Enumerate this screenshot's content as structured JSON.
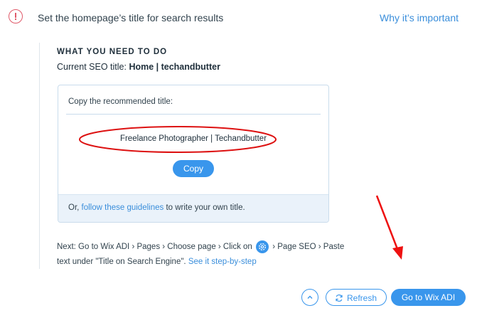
{
  "header": {
    "title": "Set the homepage’s title for search results",
    "why_link": "Why it’s important"
  },
  "instructions": {
    "heading": "WHAT YOU NEED TO DO",
    "current_seo_label": "Current SEO title: ",
    "current_seo_value": "Home | techandbutter"
  },
  "card": {
    "label": "Copy the recommended title:",
    "recommended_title": "Freelance Photographer | Techandbutter",
    "copy_button": "Copy",
    "footer_prefix": "Or, ",
    "footer_link": "follow these guidelines",
    "footer_suffix": " to write your own title."
  },
  "next_steps": {
    "part1": "Next: Go to Wix ADI › Pages › Choose page › Click on ",
    "part2": " › Page SEO › Paste text under \"Title on Search Engine\". ",
    "link": "See it step-by-step"
  },
  "actions": {
    "refresh": "Refresh",
    "goto": "Go to Wix ADI"
  },
  "colors": {
    "accent": "#3996ec",
    "alert": "#e05a6a",
    "annotation": "#dd1111"
  }
}
